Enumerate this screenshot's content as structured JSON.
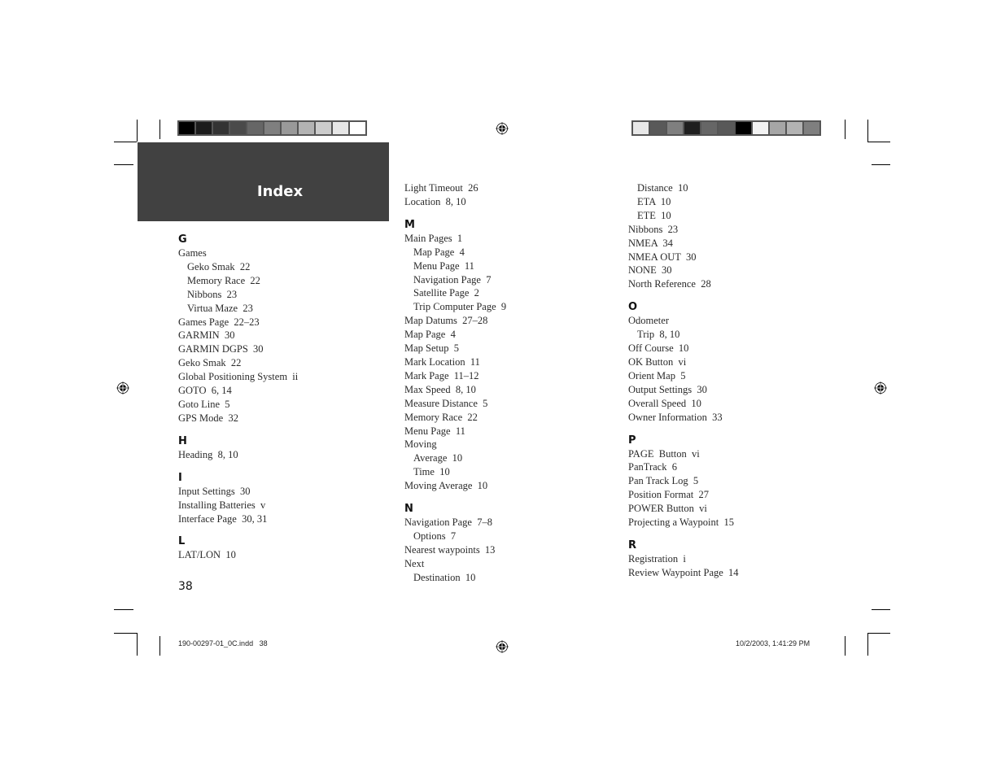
{
  "header": {
    "title": "Index"
  },
  "color_bars": {
    "left": [
      "#000000",
      "#1c1c1c",
      "#333333",
      "#4a4a4a",
      "#666666",
      "#7f7f7f",
      "#999999",
      "#b3b3b3",
      "#cccccc",
      "#e6e6e6",
      "#ffffff"
    ],
    "right": [
      "#e8e8e8",
      "#595959",
      "#7f7f7f",
      "#1f1f1f",
      "#666666",
      "#595959",
      "#000000",
      "#f2f2f2",
      "#a6a6a6",
      "#b3b3b3",
      "#7f7f7f"
    ]
  },
  "columns": [
    {
      "items": [
        {
          "type": "letter",
          "text": "G"
        },
        {
          "type": "entry",
          "text": "Games"
        },
        {
          "type": "sub",
          "text": "Geko Smak  22"
        },
        {
          "type": "sub",
          "text": "Memory Race  22"
        },
        {
          "type": "sub",
          "text": "Nibbons  23"
        },
        {
          "type": "sub",
          "text": "Virtua Maze  23"
        },
        {
          "type": "entry",
          "text": "Games Page  22–23"
        },
        {
          "type": "entry",
          "text": "GARMIN  30"
        },
        {
          "type": "entry",
          "text": "GARMIN DGPS  30"
        },
        {
          "type": "entry",
          "text": "Geko Smak  22"
        },
        {
          "type": "entry",
          "text": "Global Positioning System  ii"
        },
        {
          "type": "entry",
          "text": "GOTO  6, 14"
        },
        {
          "type": "entry",
          "text": "Goto Line  5"
        },
        {
          "type": "entry",
          "text": "GPS Mode  32"
        },
        {
          "type": "letter",
          "text": "H"
        },
        {
          "type": "entry",
          "text": "Heading  8, 10"
        },
        {
          "type": "letter",
          "text": "I"
        },
        {
          "type": "entry",
          "text": "Input Settings  30"
        },
        {
          "type": "entry",
          "text": "Installing Batteries  v"
        },
        {
          "type": "entry",
          "text": "Interface Page  30, 31"
        },
        {
          "type": "letter",
          "text": "L"
        },
        {
          "type": "entry",
          "text": "LAT/LON  10"
        }
      ]
    },
    {
      "items": [
        {
          "type": "entry",
          "text": "Light Timeout  26"
        },
        {
          "type": "entry",
          "text": "Location  8, 10"
        },
        {
          "type": "letter",
          "text": "M"
        },
        {
          "type": "entry",
          "text": "Main Pages  1"
        },
        {
          "type": "sub",
          "text": "Map Page  4"
        },
        {
          "type": "sub",
          "text": "Menu Page  11"
        },
        {
          "type": "sub",
          "text": "Navigation Page  7"
        },
        {
          "type": "sub",
          "text": "Satellite Page  2"
        },
        {
          "type": "sub",
          "text": "Trip Computer Page  9"
        },
        {
          "type": "entry",
          "text": "Map Datums  27–28"
        },
        {
          "type": "entry",
          "text": "Map Page  4"
        },
        {
          "type": "entry",
          "text": "Map Setup  5"
        },
        {
          "type": "entry",
          "text": "Mark Location  11"
        },
        {
          "type": "entry",
          "text": "Mark Page  11–12"
        },
        {
          "type": "entry",
          "text": "Max Speed  8, 10"
        },
        {
          "type": "entry",
          "text": "Measure Distance  5"
        },
        {
          "type": "entry",
          "text": "Memory Race  22"
        },
        {
          "type": "entry",
          "text": "Menu Page  11"
        },
        {
          "type": "entry",
          "text": "Moving"
        },
        {
          "type": "sub",
          "text": "Average  10"
        },
        {
          "type": "sub",
          "text": "Time  10"
        },
        {
          "type": "entry",
          "text": "Moving Average  10"
        },
        {
          "type": "letter",
          "text": "N"
        },
        {
          "type": "entry",
          "text": "Navigation Page  7–8"
        },
        {
          "type": "sub",
          "text": "Options  7"
        },
        {
          "type": "entry",
          "text": "Nearest waypoints  13"
        },
        {
          "type": "entry",
          "text": "Next"
        },
        {
          "type": "sub",
          "text": "Destination  10"
        }
      ]
    },
    {
      "items": [
        {
          "type": "sub",
          "text": "Distance  10"
        },
        {
          "type": "sub",
          "text": "ETA  10"
        },
        {
          "type": "sub",
          "text": "ETE  10"
        },
        {
          "type": "entry",
          "text": "Nibbons  23"
        },
        {
          "type": "entry",
          "text": "NMEA  34"
        },
        {
          "type": "entry",
          "text": "NMEA OUT  30"
        },
        {
          "type": "entry",
          "text": "NONE  30"
        },
        {
          "type": "entry",
          "text": "North Reference  28"
        },
        {
          "type": "letter",
          "text": "O"
        },
        {
          "type": "entry",
          "text": "Odometer"
        },
        {
          "type": "sub",
          "text": "Trip  8, 10"
        },
        {
          "type": "entry",
          "text": "Off Course  10"
        },
        {
          "type": "entry",
          "text": "OK Button  vi"
        },
        {
          "type": "entry",
          "text": "Orient Map  5"
        },
        {
          "type": "entry",
          "text": "Output Settings  30"
        },
        {
          "type": "entry",
          "text": "Overall Speed  10"
        },
        {
          "type": "entry",
          "text": "Owner Information  33"
        },
        {
          "type": "letter",
          "text": "P"
        },
        {
          "type": "entry",
          "text": "PAGE  Button  vi"
        },
        {
          "type": "entry",
          "text": "PanTrack  6"
        },
        {
          "type": "entry",
          "text": "Pan Track Log  5"
        },
        {
          "type": "entry",
          "text": "Position Format  27"
        },
        {
          "type": "entry",
          "text": "POWER Button  vi"
        },
        {
          "type": "entry",
          "text": "Projecting a Waypoint  15"
        },
        {
          "type": "letter",
          "text": "R"
        },
        {
          "type": "entry",
          "text": "Registration  i"
        },
        {
          "type": "entry",
          "text": "Review Waypoint Page  14"
        }
      ]
    }
  ],
  "footer": {
    "page_number": "38",
    "slug_file": "190-00297-01_0C.indd   38",
    "slug_date": "10/2/2003, 1:41:29 PM"
  },
  "icons": {
    "registration_mark": "crosshair-target-icon"
  }
}
